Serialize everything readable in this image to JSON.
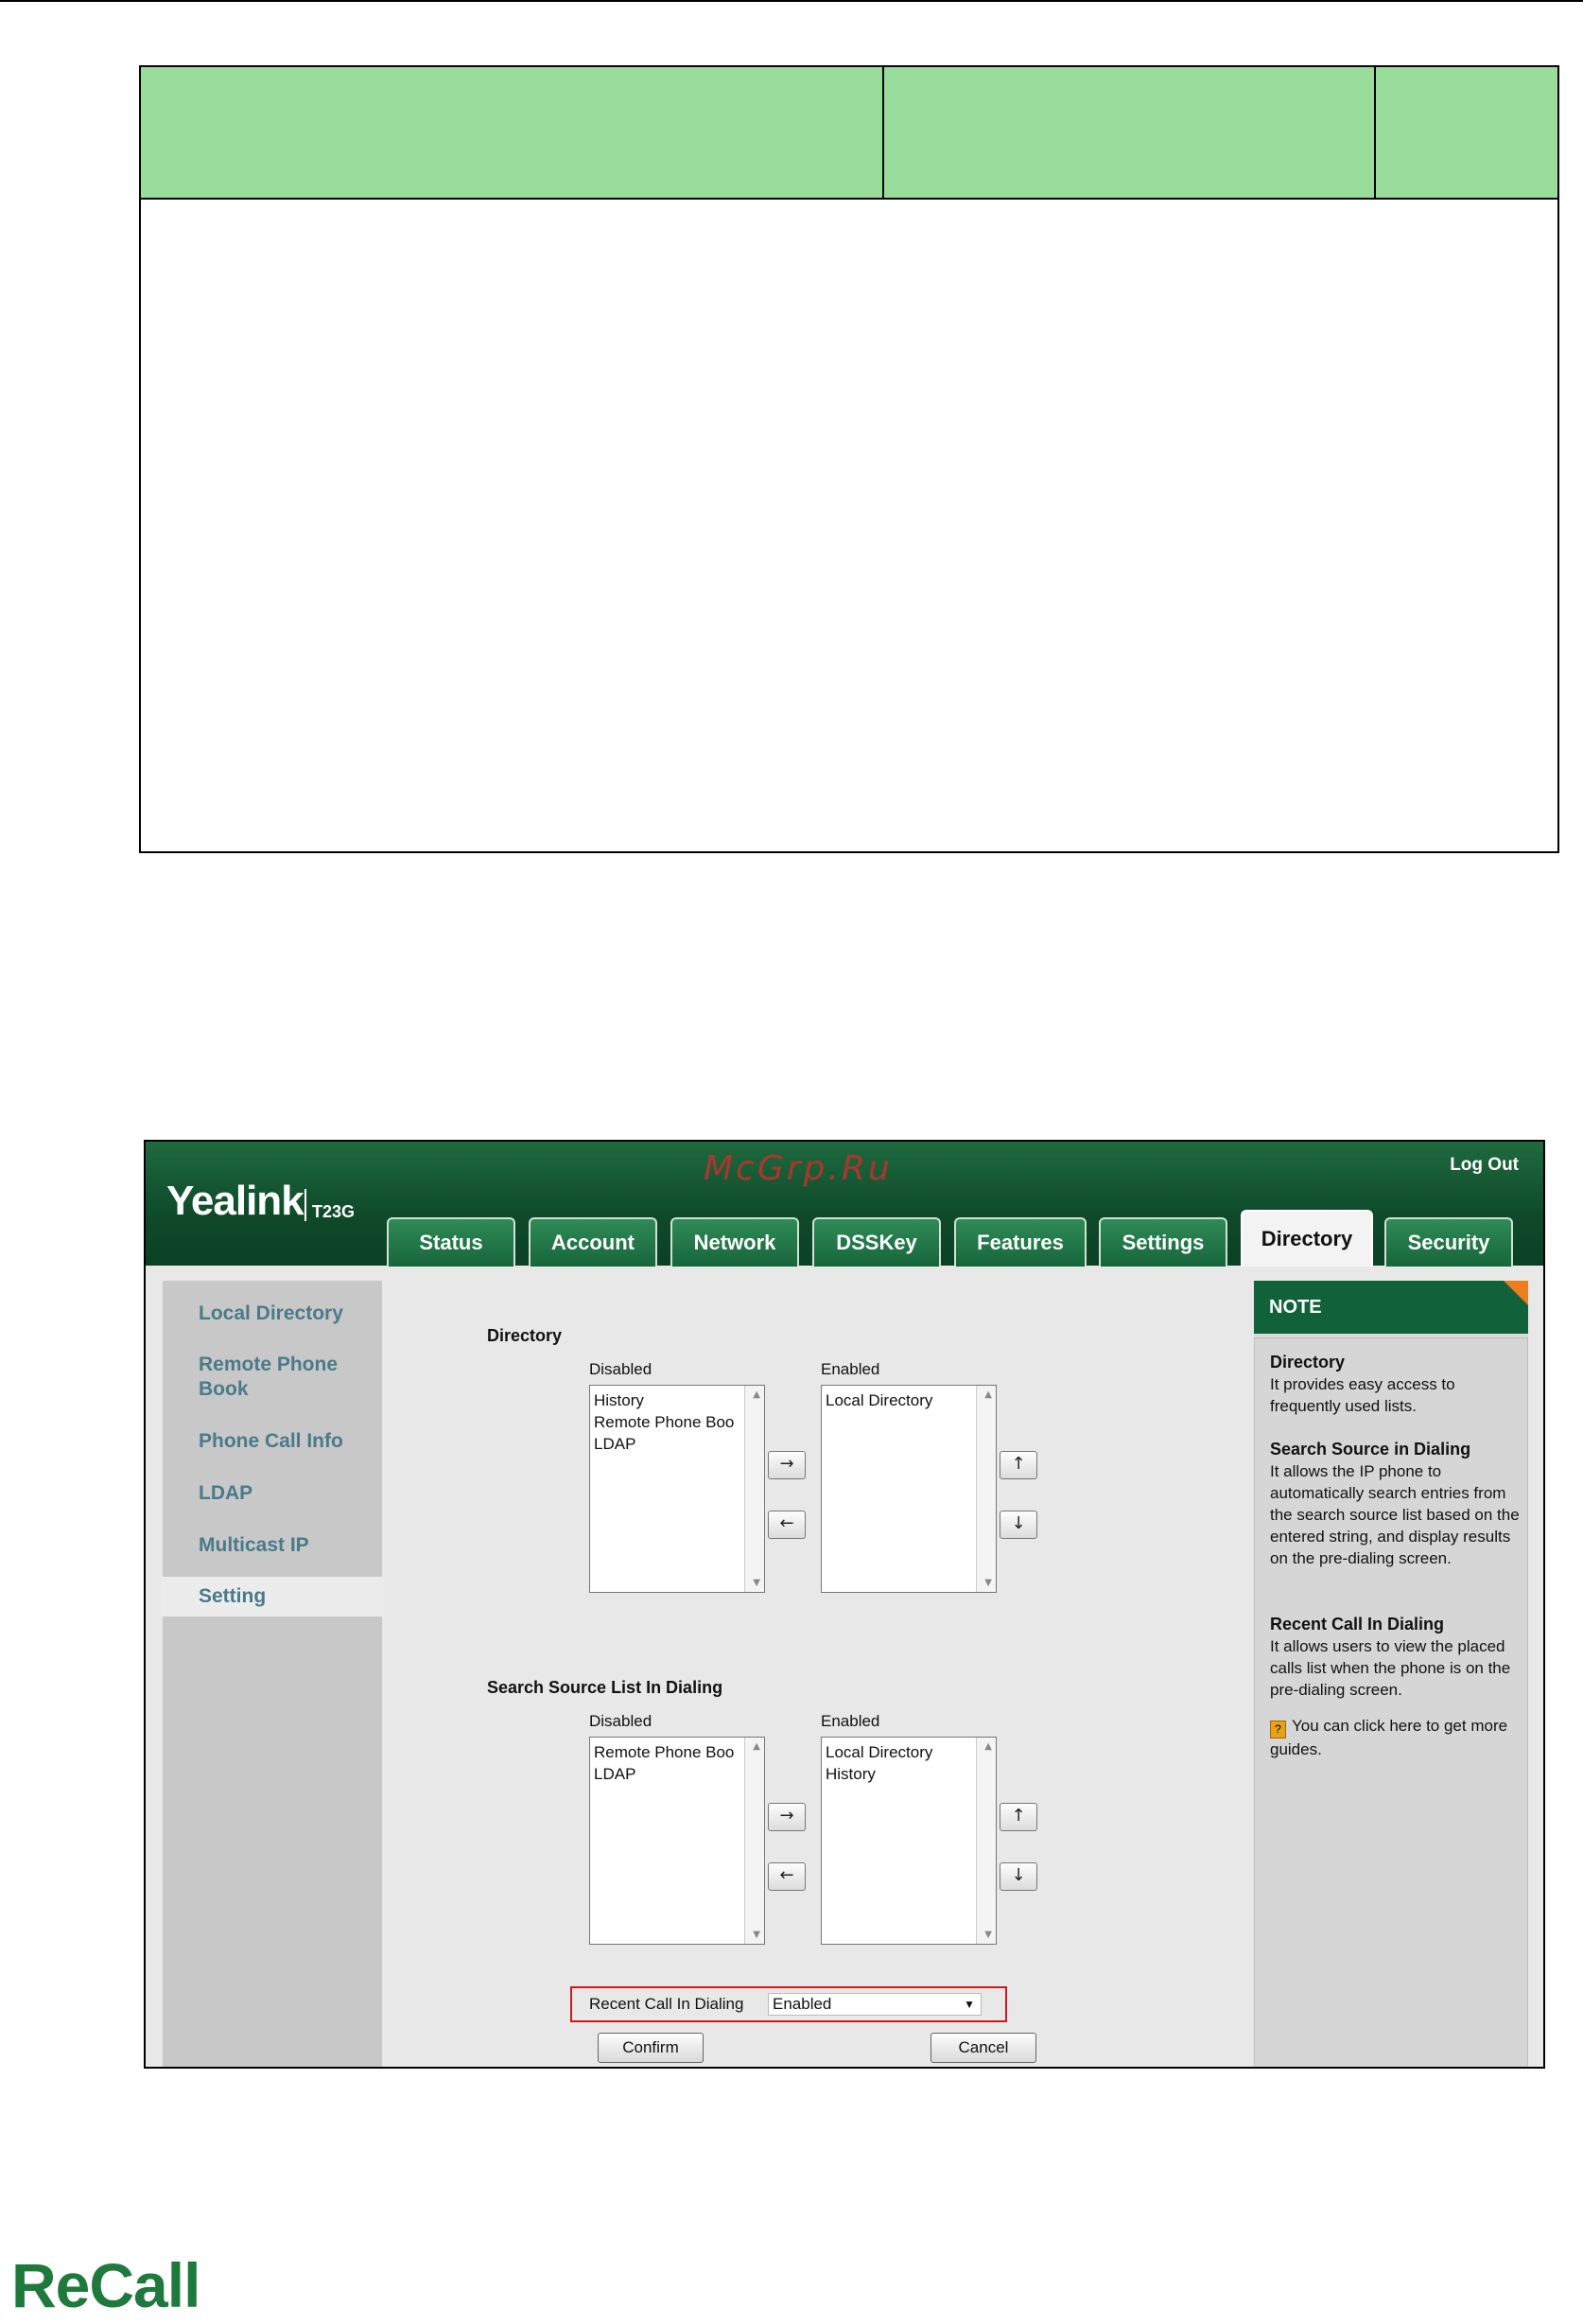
{
  "watermark": "McGrp.Ru",
  "brand": {
    "logo": "Yealink",
    "model": "T23G"
  },
  "header": {
    "logout": "Log Out"
  },
  "tabs": [
    "Status",
    "Account",
    "Network",
    "DSSKey",
    "Features",
    "Settings",
    "Directory",
    "Security"
  ],
  "active_tab": "Directory",
  "sidebar": {
    "items": [
      "Local Directory",
      "Remote Phone Book",
      "Phone Call Info",
      "LDAP",
      "Multicast IP",
      "Setting"
    ],
    "active": "Setting"
  },
  "directory": {
    "title": "Directory",
    "disabled_label": "Disabled",
    "enabled_label": "Enabled",
    "disabled_items": [
      "History",
      "Remote Phone Boo",
      "LDAP"
    ],
    "enabled_items": [
      "Local Directory"
    ]
  },
  "search_source": {
    "title": "Search Source List In Dialing",
    "disabled_label": "Disabled",
    "enabled_label": "Enabled",
    "disabled_items": [
      "Remote Phone Boo",
      "LDAP"
    ],
    "enabled_items": [
      "Local Directory",
      "History"
    ]
  },
  "arrows": {
    "right": "→",
    "left": "←",
    "up": "↑",
    "down": "↓"
  },
  "recent_call": {
    "label": "Recent Call In Dialing",
    "value": "Enabled"
  },
  "buttons": {
    "confirm": "Confirm",
    "cancel": "Cancel"
  },
  "note": {
    "title": "NOTE",
    "sections": [
      {
        "heading": "Directory",
        "text": "It provides easy access to frequently used lists."
      },
      {
        "heading": "Search Source in Dialing",
        "text": "It allows the IP phone to automatically search entries from the search source list based on the entered string, and display results on the pre-dialing screen."
      },
      {
        "heading": "Recent Call In Dialing",
        "text": "It allows users to view the placed calls list when the phone is on the pre-dialing screen."
      }
    ],
    "guide": "You can click here to get more guides.",
    "help_icon": "?"
  },
  "footer_logo": "ReCall",
  "icons": {
    "scroll_up": "up-triangle",
    "scroll_down": "down-triangle",
    "dropdown": "down-triangle"
  }
}
